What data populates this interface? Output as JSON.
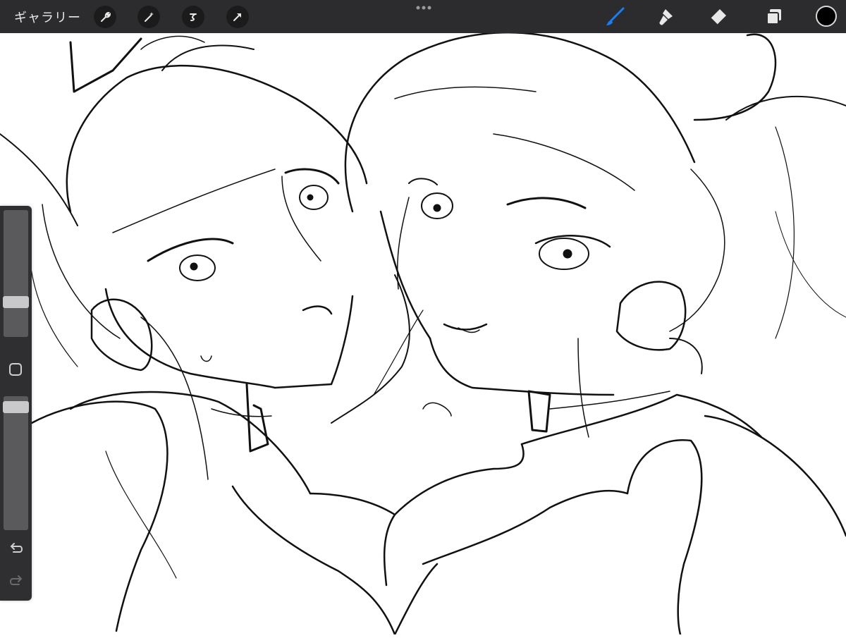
{
  "toolbar": {
    "gallery_label": "ギャラリー",
    "left_tools": [
      "wrench-icon",
      "magic-wand-icon",
      "selection-icon",
      "transform-arrow-icon"
    ],
    "right_tools": [
      "brush-icon",
      "smudge-icon",
      "eraser-icon",
      "layers-icon"
    ],
    "active_tool": "brush-icon",
    "active_color": "#000000",
    "accent_color": "#1c7cf4"
  },
  "sidebar": {
    "brush_size_level": 0.25,
    "opacity_level": 0.96,
    "undo": "undo-icon",
    "redo": "redo-icon"
  }
}
